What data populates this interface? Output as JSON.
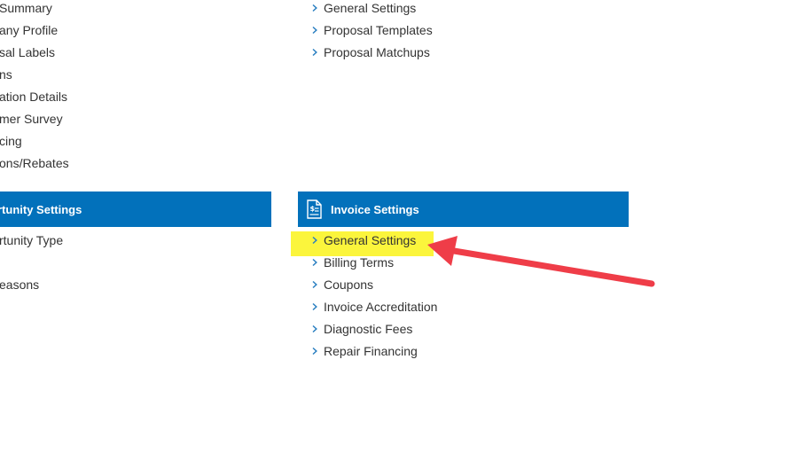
{
  "left_section": {
    "top_links": [
      {
        "label": "Summary"
      },
      {
        "label": "any Profile"
      },
      {
        "label": "sal Labels"
      },
      {
        "label": "ns"
      },
      {
        "label": "ation Details"
      },
      {
        "label": "mer Survey"
      },
      {
        "label": "cing"
      },
      {
        "label": "ons/Rebates"
      }
    ],
    "header": {
      "title": "rtunity Settings"
    },
    "bottom_links": [
      {
        "label": "rtunity Type"
      },
      {
        "label": ""
      },
      {
        "label": "easons"
      }
    ]
  },
  "right_section": {
    "top_links": [
      {
        "label": "General Settings"
      },
      {
        "label": "Proposal Templates"
      },
      {
        "label": "Proposal Matchups"
      }
    ],
    "header": {
      "title": "Invoice Settings",
      "icon": "invoice-dollar-icon"
    },
    "bottom_links": [
      {
        "label": "General Settings"
      },
      {
        "label": "Billing Terms"
      },
      {
        "label": "Coupons"
      },
      {
        "label": "Invoice Accreditation"
      },
      {
        "label": "Diagnostic Fees"
      },
      {
        "label": "Repair Financing"
      }
    ]
  },
  "annotation": {
    "highlight_color": "#fbf53c",
    "arrow_color": "#ef3d48",
    "header_color": "#0271bb"
  }
}
